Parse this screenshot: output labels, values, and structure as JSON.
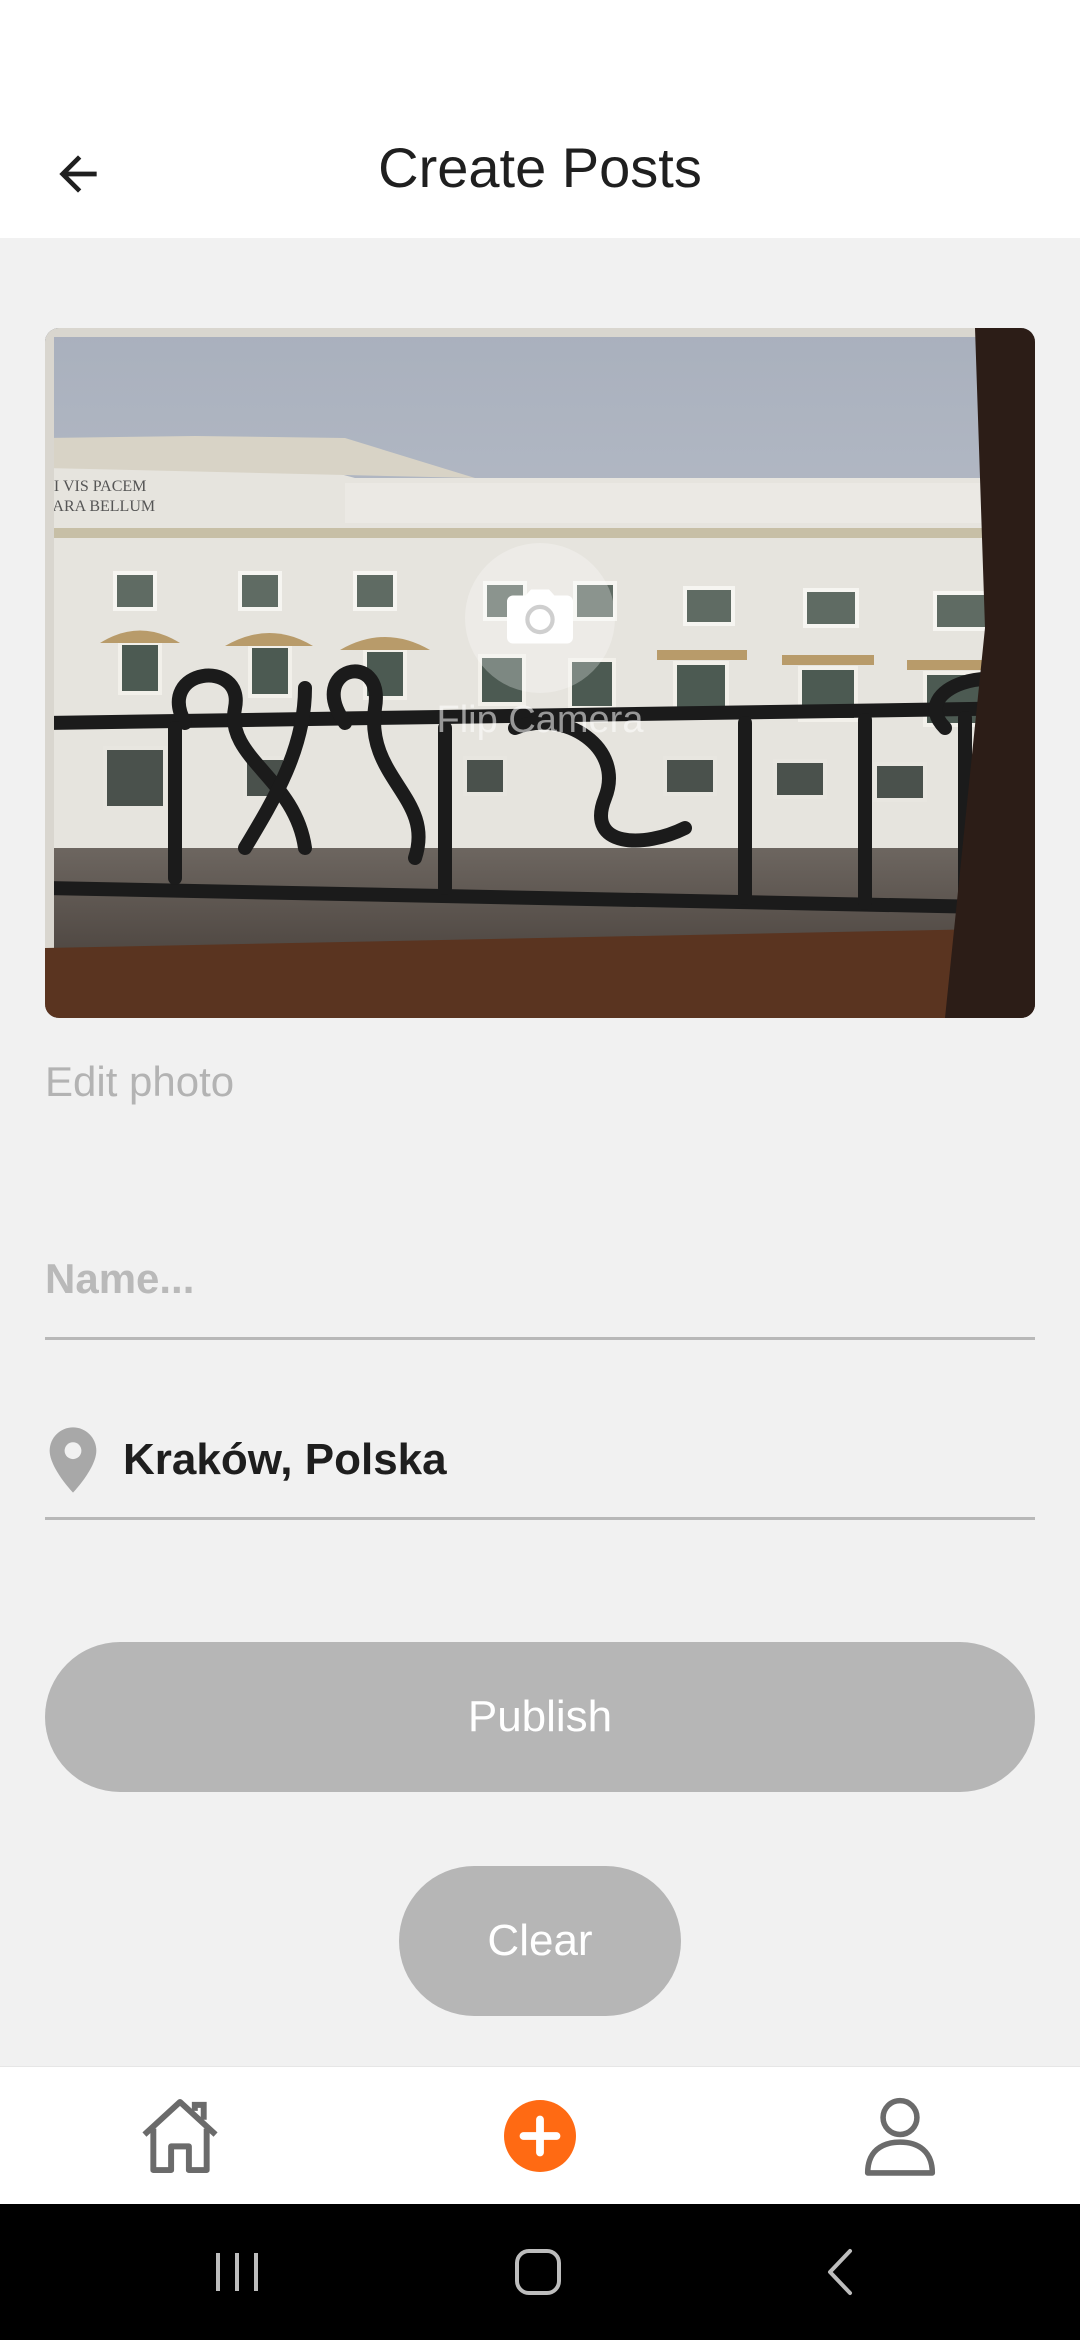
{
  "header": {
    "title": "Create Posts",
    "back_icon": "arrow-left-icon"
  },
  "photo": {
    "flip_camera_label": "Flip Camera",
    "camera_icon": "camera-icon",
    "engraved_text_line1": "SI VIS PACEM",
    "engraved_text_line2": "PARA BELLUM"
  },
  "edit_photo_label": "Edit photo",
  "name_field": {
    "value": "",
    "placeholder": "Name..."
  },
  "location": {
    "icon": "location-pin-icon",
    "value": "Kraków, Polska"
  },
  "buttons": {
    "publish": "Publish",
    "clear": "Clear"
  },
  "bottom_nav": {
    "items": [
      {
        "icon": "home-icon"
      },
      {
        "icon": "add-post-icon"
      },
      {
        "icon": "profile-icon"
      }
    ]
  },
  "colors": {
    "accent": "#ff6a13",
    "button_disabled": "#b6b6b6",
    "background": "#f1f1f1"
  }
}
